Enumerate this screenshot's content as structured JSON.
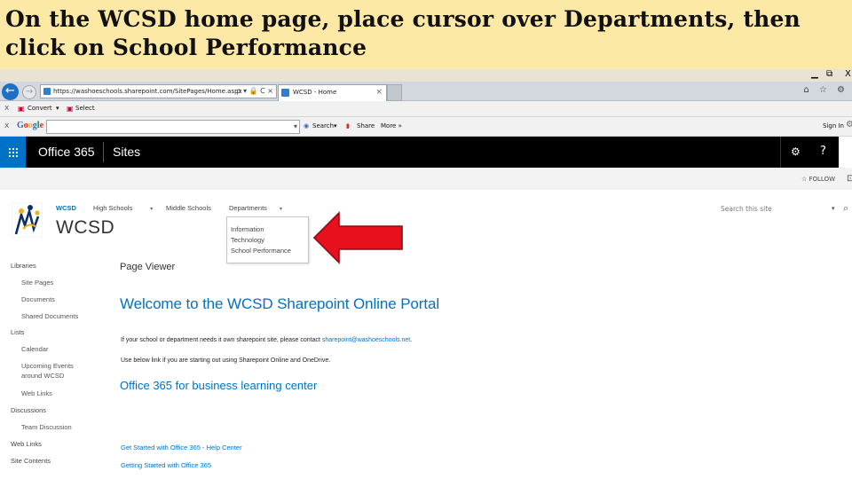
{
  "banner": {
    "line1": "On the WCSD home page, place cursor over Departments, then",
    "line2": "click on School Performance"
  },
  "window": {
    "minimize": "▁",
    "restore": "⧉",
    "close": "X"
  },
  "browser": {
    "url": "https://washoeschools.sharepoint.com/SitePages/Home.aspx",
    "url_tools": "ρ ▾ 🔒 C ×",
    "tab_title": "WCSD - Home",
    "tab_close": "×",
    "right_icons": "⌂ ☆ ⚙"
  },
  "toolbar1": {
    "close": "x",
    "convert": "Convert",
    "convert_caret": "▾",
    "select": "Select"
  },
  "toolbar2": {
    "close": "x",
    "google": "Google",
    "search": "Search",
    "search_caret": "▾",
    "share": "Share",
    "more": "More »",
    "signin": "Sign In",
    "settings_icon": "⚙"
  },
  "suitebar": {
    "brand": "Office 365",
    "sites": "Sites",
    "help": "?"
  },
  "followbar": {
    "follow": "☆ FOLLOW",
    "more": "⊡"
  },
  "site": {
    "title": "WCSD",
    "nav": [
      {
        "label": "WCSD"
      },
      {
        "label": "High Schools"
      },
      {
        "label": "Middle Schools"
      },
      {
        "label": "Departments"
      }
    ],
    "search_placeholder": "Search this site",
    "departments_menu": [
      "Information",
      "Technology",
      "School Performance"
    ]
  },
  "quick_launch": [
    {
      "label": "Libraries",
      "level": 0
    },
    {
      "label": "Site Pages",
      "level": 1
    },
    {
      "label": "Documents",
      "level": 1
    },
    {
      "label": "Shared Documents",
      "level": 1
    },
    {
      "label": "Lists",
      "level": 0
    },
    {
      "label": "Calendar",
      "level": 1
    },
    {
      "label": "Upcoming Events",
      "level": 1
    },
    {
      "label": "around WCSD",
      "level": 1
    },
    {
      "label": "Web Links",
      "level": 1
    },
    {
      "label": "Discussions",
      "level": 0
    },
    {
      "label": "Team Discussion",
      "level": 1
    },
    {
      "label": "Web Links",
      "level": 0
    },
    {
      "label": "Site Contents",
      "level": 0
    }
  ],
  "main": {
    "page_viewer": "Page Viewer",
    "welcome": "Welcome to the WCSD Sharepoint Online Portal",
    "para1_prefix": "If your school or department needs it own sharepoint site, please contact ",
    "para1_email": "sharepoint@washoeschools.net",
    "para1_suffix": ".",
    "para2": "Use below link if you are starting out using Sharepoint Online and OneDrive.",
    "learning_center": "Office 365 for business learning center",
    "link1": "Get Started with Office 365 - Help Center",
    "link2": "Getting Started with Office 365"
  },
  "colors": {
    "banner": "#fde9a6",
    "accent": "#0072c6",
    "suitebar": "#000000",
    "arrow": "#e8101c"
  }
}
